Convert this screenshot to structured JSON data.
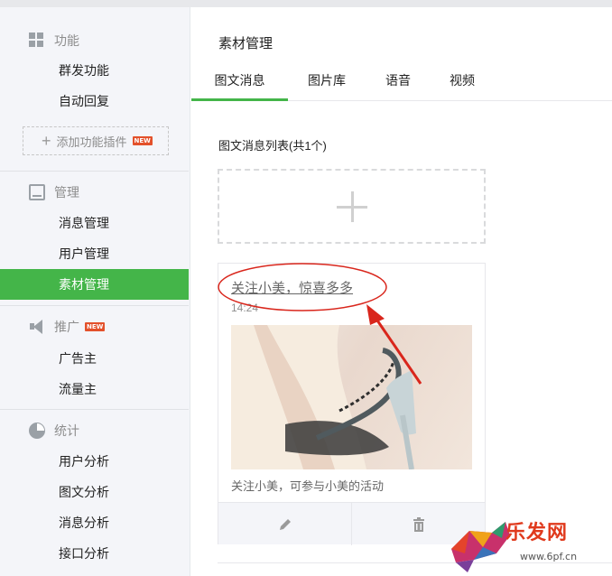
{
  "sidebar": {
    "sections": [
      {
        "title": "功能",
        "icon": "grid-icon",
        "items": [
          "群发功能",
          "自动回复"
        ],
        "add_plugin": "添加功能插件"
      },
      {
        "title": "管理",
        "icon": "tray-icon",
        "items": [
          "消息管理",
          "用户管理",
          "素材管理"
        ],
        "active": "素材管理"
      },
      {
        "title": "推广",
        "icon": "megaphone-icon",
        "items": [
          "广告主",
          "流量主"
        ]
      },
      {
        "title": "统计",
        "icon": "pie-chart-icon",
        "items": [
          "用户分析",
          "图文分析",
          "消息分析",
          "接口分析"
        ]
      }
    ],
    "new_badge": "NEW"
  },
  "main": {
    "title": "素材管理",
    "tabs": [
      {
        "label": "图文消息",
        "active": true
      },
      {
        "label": "图片库"
      },
      {
        "label": "语音"
      },
      {
        "label": "视频"
      }
    ],
    "list_title": "图文消息列表(共1个)",
    "card": {
      "title": "关注小美，惊喜多多",
      "time": "14:24",
      "desc": "关注小美，可参与小美的活动",
      "actions": [
        "edit-icon",
        "delete-icon"
      ]
    }
  },
  "watermark": {
    "text": "乐发网",
    "url": "www.6pf.cn"
  },
  "colors": {
    "accent": "#44b549",
    "annotation": "#d9261c",
    "badge": "#e3512b"
  }
}
